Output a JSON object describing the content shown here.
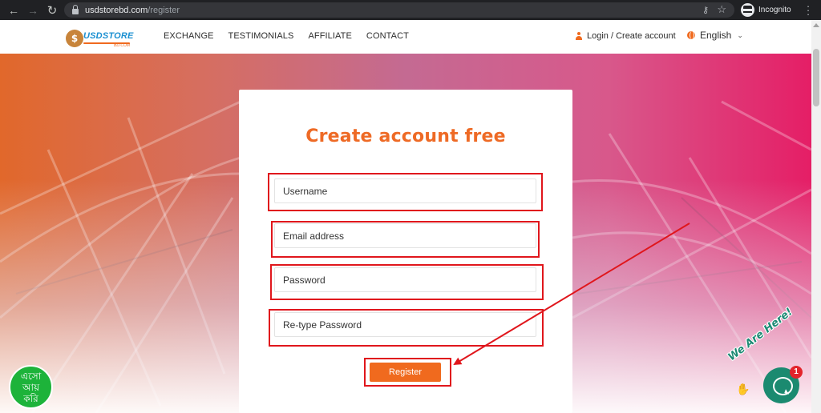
{
  "browser": {
    "url_host": "usdstorebd.com",
    "url_path": "/register",
    "profile_label": "Incognito"
  },
  "header": {
    "logo_text": "USDSTORE",
    "logo_subtext": "BD.COM",
    "nav_items": [
      "EXCHANGE",
      "TESTIMONIALS",
      "AFFILIATE",
      "CONTACT"
    ],
    "login_label": "Login / Create account",
    "language_label": "English"
  },
  "form": {
    "title": "Create account free",
    "username_placeholder": "Username",
    "email_placeholder": "Email address",
    "password_placeholder": "Password",
    "retype_password_placeholder": "Re-type Password",
    "submit_label": "Register"
  },
  "badge": {
    "lines": [
      "এসো",
      "আয়",
      "করি"
    ]
  },
  "chat": {
    "tagline": "We Are Here!",
    "unread_count": "1"
  },
  "colors": {
    "accent": "#f06a1e",
    "annotation": "#e0161c",
    "chat": "#1b8a70"
  }
}
